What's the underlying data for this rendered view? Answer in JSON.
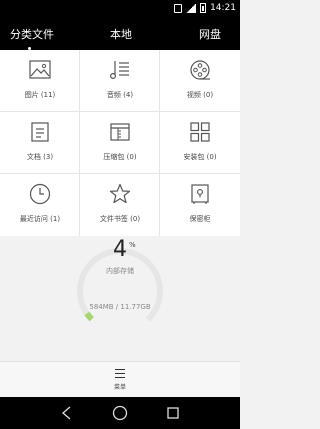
{
  "status_bar": {
    "time": "14:21"
  },
  "tabs": [
    {
      "label": "分类文件"
    },
    {
      "label": "本地"
    },
    {
      "label": "网盘"
    }
  ],
  "categories": [
    {
      "label": "图片 (11)",
      "icon": "image-icon"
    },
    {
      "label": "音频 (4)",
      "icon": "music-icon"
    },
    {
      "label": "视频 (0)",
      "icon": "video-reel-icon"
    },
    {
      "label": "文档 (3)",
      "icon": "document-icon"
    },
    {
      "label": "压缩包 (0)",
      "icon": "archive-icon"
    },
    {
      "label": "安装包 (0)",
      "icon": "grid-apps-icon"
    },
    {
      "label": "最近访问 (1)",
      "icon": "clock-icon"
    },
    {
      "label": "文件书签 (0)",
      "icon": "star-icon"
    },
    {
      "label": "保密柜",
      "icon": "safe-lock-icon"
    }
  ],
  "storage": {
    "percent": "4",
    "percent_sign": "%",
    "label": "内部存储",
    "usage": "584MB / 11.77GB",
    "accent_color": "#a6d76e"
  },
  "menu": {
    "label": "菜单"
  }
}
